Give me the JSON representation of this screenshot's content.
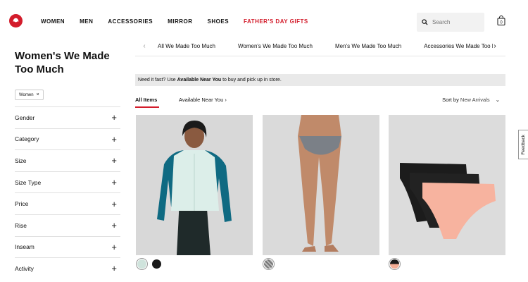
{
  "header": {
    "nav": [
      "WOMEN",
      "MEN",
      "ACCESSORIES",
      "MIRROR",
      "SHOES",
      "FATHER'S DAY GIFTS"
    ],
    "search_placeholder": "Search",
    "highlight_color": "#d31c2b"
  },
  "sidebar": {
    "title": "Women's We Made Too Much",
    "active_filter": "Women",
    "filters": [
      "Gender",
      "Category",
      "Size",
      "Size Type",
      "Price",
      "Rise",
      "Inseam",
      "Activity"
    ]
  },
  "categories": [
    "All We Made Too Much",
    "Women's We Made Too Much",
    "Men's We Made Too Much",
    "Accessories We Made Too M"
  ],
  "notice": {
    "prefix": "Need it fast? Use ",
    "bold": "Available Near You",
    "suffix": " to buy and pick up in store."
  },
  "tabs": {
    "all": "All Items",
    "near": "Available Near You"
  },
  "sort": {
    "label": "Sort by",
    "value": "New Arrivals"
  },
  "products": [
    {
      "name": "vest-product",
      "swatches": [
        "#cfe3dc",
        "#1a1a1a"
      ]
    },
    {
      "name": "underwear-product",
      "swatches": [
        "#8a8f96"
      ]
    },
    {
      "name": "underwear-3-pack-product",
      "swatches": [
        "#f4ad95"
      ]
    }
  ],
  "feedback": "Feedback"
}
